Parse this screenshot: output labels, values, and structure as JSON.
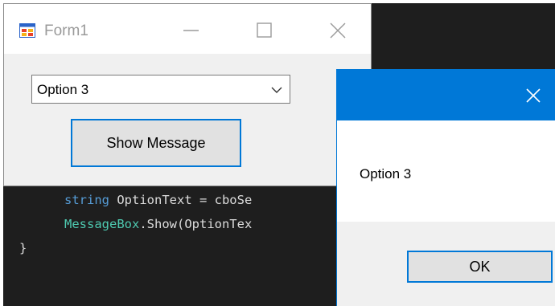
{
  "editor": {
    "lines": [
      {
        "kw": "string",
        "rest": " OptionText = cboSe"
      },
      {
        "cls": "MessageBox",
        "rest": ".Show(OptionTex"
      },
      {
        "text": "}"
      }
    ]
  },
  "form": {
    "title": "Form1",
    "icon": "winforms-app-icon",
    "combo": {
      "value": "Option 3"
    },
    "show_button_label": "Show Message"
  },
  "message_box": {
    "text": "Option 3",
    "ok_label": "OK"
  },
  "colors": {
    "accent": "#0078d7",
    "editor_bg": "#1e1e1e",
    "keyword": "#569cd6",
    "type": "#4ec9b0"
  }
}
